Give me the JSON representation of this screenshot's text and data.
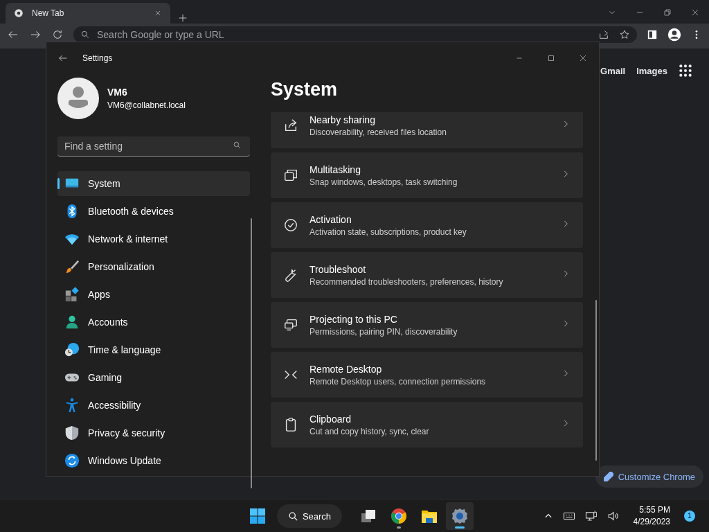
{
  "browser": {
    "tab": {
      "title": "New Tab"
    },
    "address_bar": {
      "placeholder": "Search Google or type a URL"
    },
    "links": [
      "Gmail",
      "Images"
    ],
    "customize_button": "Customize Chrome"
  },
  "settings_window": {
    "title": "Settings",
    "user": {
      "name": "VM6",
      "email": "VM6@collabnet.local"
    },
    "search": {
      "placeholder": "Find a setting"
    },
    "nav": [
      {
        "label": "System",
        "selected": true
      },
      {
        "label": "Bluetooth & devices",
        "selected": false
      },
      {
        "label": "Network & internet",
        "selected": false
      },
      {
        "label": "Personalization",
        "selected": false
      },
      {
        "label": "Apps",
        "selected": false
      },
      {
        "label": "Accounts",
        "selected": false
      },
      {
        "label": "Time & language",
        "selected": false
      },
      {
        "label": "Gaming",
        "selected": false
      },
      {
        "label": "Accessibility",
        "selected": false
      },
      {
        "label": "Privacy & security",
        "selected": false
      },
      {
        "label": "Windows Update",
        "selected": false
      }
    ],
    "page_title": "System",
    "items": [
      {
        "title": "Nearby sharing",
        "description": "Discoverability, received files location"
      },
      {
        "title": "Multitasking",
        "description": "Snap windows, desktops, task switching"
      },
      {
        "title": "Activation",
        "description": "Activation state, subscriptions, product key"
      },
      {
        "title": "Troubleshoot",
        "description": "Recommended troubleshooters, preferences, history"
      },
      {
        "title": "Projecting to this PC",
        "description": "Permissions, pairing PIN, discoverability"
      },
      {
        "title": "Remote Desktop",
        "description": "Remote Desktop users, connection permissions"
      },
      {
        "title": "Clipboard",
        "description": "Cut and copy history, sync, clear"
      }
    ]
  },
  "taskbar": {
    "search_label": "Search",
    "apps": [
      {
        "selected": false,
        "running": false
      },
      {
        "selected": false,
        "running": true
      },
      {
        "selected": false,
        "running": false
      },
      {
        "selected": true,
        "running": true
      }
    ],
    "clock": {
      "time": "5:55 PM",
      "date": "4/29/2023"
    },
    "notification_count": "1"
  }
}
